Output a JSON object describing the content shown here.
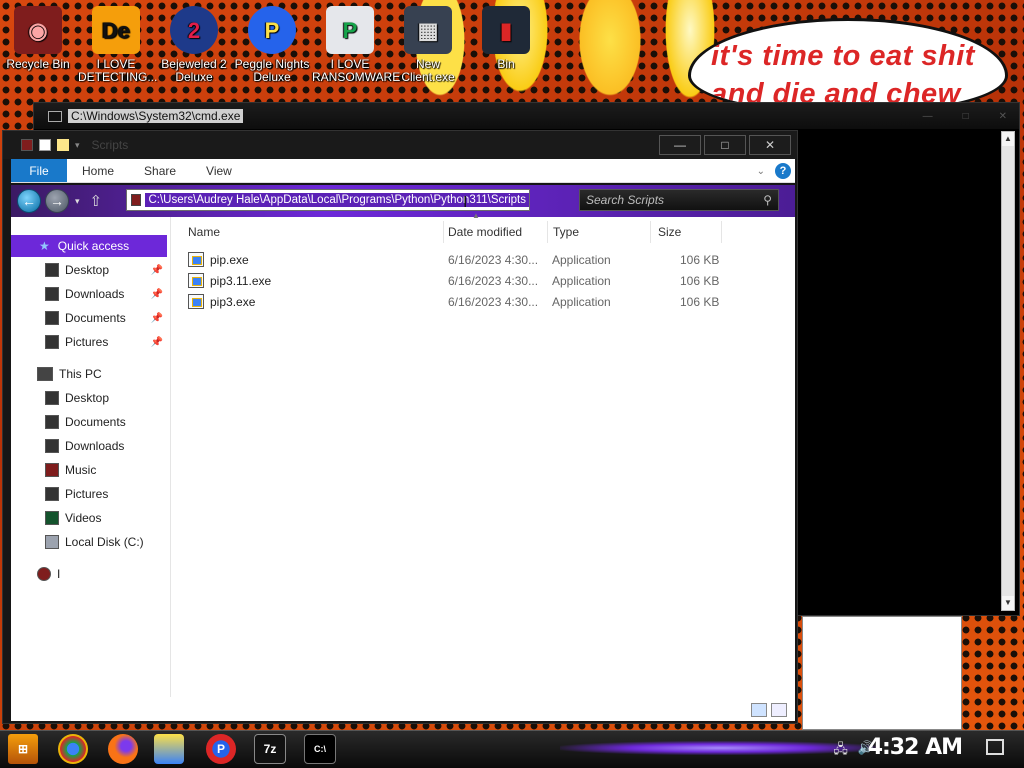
{
  "wallpaper": {
    "speech_bubble_text": "it's time to eat shit and die and chew"
  },
  "desktop_icons": [
    {
      "label": "Recycle Bin",
      "glyph": "◉",
      "color": "#b91c1c"
    },
    {
      "label": "I LOVE DETECTING...",
      "glyph": "De",
      "color": "#f59e0b"
    },
    {
      "label": "Bejeweled 2 Deluxe",
      "glyph": "2",
      "color": "#e11d48"
    },
    {
      "label": "Peggle Nights Deluxe",
      "glyph": "P",
      "color": "#2563eb"
    },
    {
      "label": "I LOVE RANSOMWARE",
      "glyph": "P",
      "color": "#16a34a"
    },
    {
      "label": "New Client.exe",
      "glyph": "▦",
      "color": "#374151"
    },
    {
      "label": "Bin",
      "glyph": "▮",
      "color": "#7f1d1d"
    }
  ],
  "cmd_window": {
    "title": "C:\\Windows\\System32\\cmd.exe",
    "minimize": "—",
    "maximize": "□",
    "close": "✕"
  },
  "explorer": {
    "title": "Scripts",
    "window_controls": {
      "minimize": "—",
      "maximize": "□",
      "close": "✕"
    },
    "ribbon_tabs": [
      "File",
      "Home",
      "Share",
      "View"
    ],
    "ribbon_help": "?",
    "address_path": "C:\\Users\\Audrey Hale\\AppData\\Local\\Programs\\Python\\Python311\\Scripts",
    "search_placeholder": "Search Scripts",
    "navigation": {
      "quick_access": "Quick access",
      "quick_items": [
        "Desktop",
        "Downloads",
        "Documents",
        "Pictures"
      ],
      "this_pc": "This PC",
      "pc_items": [
        "Desktop",
        "Documents",
        "Downloads",
        "Music",
        "Pictures",
        "Videos",
        "Local Disk (C:)"
      ],
      "other": "I"
    },
    "columns": {
      "name": "Name",
      "date": "Date modified",
      "type": "Type",
      "size": "Size"
    },
    "files": [
      {
        "name": "pip.exe",
        "date": "6/16/2023 4:30...",
        "type": "Application",
        "size": "106 KB"
      },
      {
        "name": "pip3.11.exe",
        "date": "6/16/2023 4:30...",
        "type": "Application",
        "size": "106 KB"
      },
      {
        "name": "pip3.exe",
        "date": "6/16/2023 4:30...",
        "type": "Application",
        "size": "106 KB"
      }
    ]
  },
  "taskbar": {
    "apps": [
      "chrome-icon",
      "firefox-icon",
      "file-explorer-icon",
      "peggle-icon",
      "7zip-icon",
      "cmd-icon"
    ],
    "seven_zip_label": "7z",
    "clock": "4:32 AM",
    "tray": [
      "network-icon",
      "volume-icon"
    ]
  },
  "colors": {
    "accent_purple": "#6d28d9",
    "file_tab_blue": "#1979ca",
    "wallpaper_orange": "#c2410c"
  }
}
